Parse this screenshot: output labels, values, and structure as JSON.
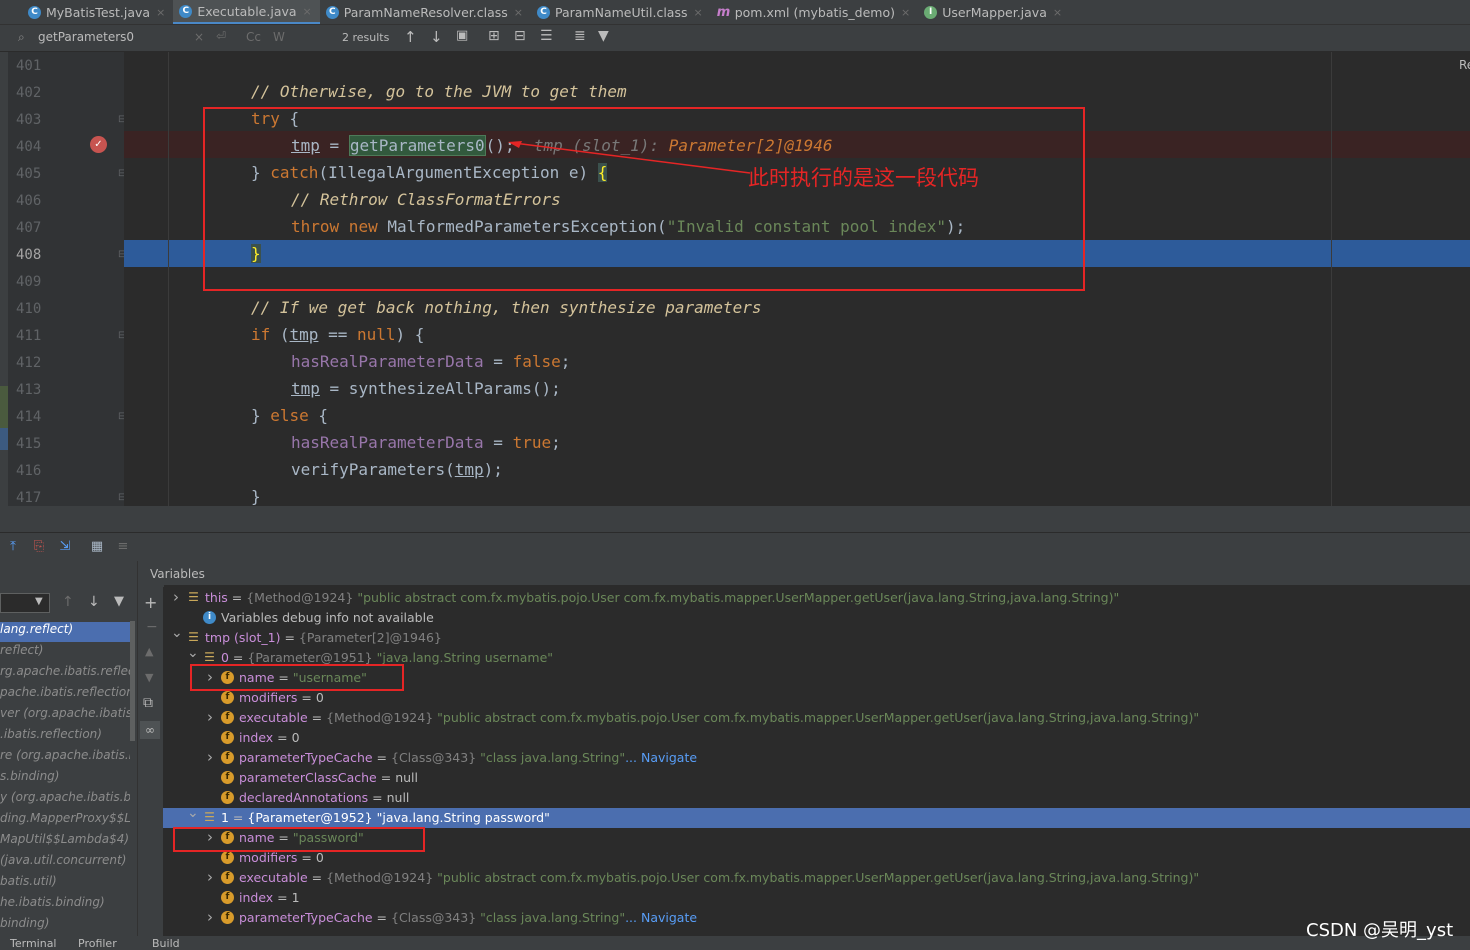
{
  "tabs": [
    {
      "label": "MyBatisTest.java",
      "icon": "java-class-icon",
      "color": "#3f8ac8"
    },
    {
      "label": "Executable.java",
      "icon": "java-class-icon",
      "color": "#3f8ac8",
      "active": true
    },
    {
      "label": "ParamNameResolver.class",
      "icon": "class-file-icon",
      "color": "#3f8ac8"
    },
    {
      "label": "ParamNameUtil.class",
      "icon": "class-file-icon",
      "color": "#3f8ac8"
    },
    {
      "label": "pom.xml (mybatis_demo)",
      "icon": "maven-icon",
      "color": "#c67ecb"
    },
    {
      "label": "UserMapper.java",
      "icon": "interface-icon",
      "color": "#6aab73"
    }
  ],
  "find": {
    "value": "getParameters0",
    "results": "2 results",
    "cc": "Cc",
    "w": "W"
  },
  "editor": {
    "line_numbers": [
      "401",
      "402",
      "403",
      "404",
      "405",
      "406",
      "407",
      "408",
      "409",
      "410",
      "411",
      "412",
      "413",
      "414",
      "415",
      "416",
      "417"
    ],
    "current_line": "408",
    "right_edge_label": "Re",
    "annotation": "此时执行的是这一段代码"
  },
  "code": {
    "l402": "// Otherwise, go to the JVM to get them",
    "l403_kw": "try",
    "l403_brace": " {",
    "l404_var": "tmp",
    "l404_eq": " = ",
    "l404_call": "getParameters0",
    "l404_tail": "();",
    "l404_hint": "tmp (slot_1):",
    "l404_hintval": "Parameter[2]@1946",
    "l405_a": "} ",
    "l405_kw": "catch",
    "l405_b": "(IllegalArgumentException e) ",
    "l405_brace": "{",
    "l406": "// Rethrow ClassFormatErrors",
    "l407_kw1": "throw",
    "l407_kw2": " new",
    "l407_cls": " MalformedParametersException(",
    "l407_str": "\"Invalid constant pool index\"",
    "l407_end": ");",
    "l408": "}",
    "l410": "// If we get back nothing, then synthesize parameters",
    "l411_kw": "if",
    "l411_a": " (",
    "l411_var": "tmp",
    "l411_b": " == ",
    "l411_null": "null",
    "l411_c": ") {",
    "l412_fld": "hasRealParameterData",
    "l412_a": " = ",
    "l412_val": "false",
    "l412_b": ";",
    "l413_var": "tmp",
    "l413_a": " = synthesizeAllParams();",
    "l414_a": "} ",
    "l414_kw": "else",
    "l414_b": " {",
    "l415_fld": "hasRealParameterData",
    "l415_a": " = ",
    "l415_val": "true",
    "l415_b": ";",
    "l416_a": "verifyParameters(",
    "l416_var": "tmp",
    "l416_b": ");",
    "l417": "}"
  },
  "debug": {
    "variables_title": "Variables",
    "frames": [
      "lang.reflect)",
      "reflect)",
      "rg.apache.ibatis.reflectio",
      "pache.ibatis.reflection)",
      "ver (org.apache.ibatis.re",
      ".ibatis.reflection)",
      "re (org.apache.ibatis.bi",
      "s.binding)",
      "y (org.apache.ibatis.bin",
      "ding.MapperProxy$$Lam",
      "MapUtil$$Lambda$4)",
      "(java.util.concurrent)",
      "batis.util)",
      "he.ibatis.binding)",
      "binding)"
    ],
    "variables": [
      {
        "name": "this",
        "eq": " = ",
        "ref": "{Method@1924}",
        "val": " \"public abstract com.fx.mybatis.pojo.User com.fx.mybatis.mapper.UserMapper.getUser(java.lang.String,java.lang.String)\""
      },
      {
        "info": "Variables debug info not available"
      },
      {
        "name": "tmp (slot_1)",
        "eq": " = ",
        "ref": "{Parameter[2]@1946}"
      },
      {
        "name": "0",
        "eq": " = ",
        "ref": "{Parameter@1951}",
        "val": " \"java.lang.String username\""
      },
      {
        "name": "name",
        "eq": " = ",
        "val": "\"username\""
      },
      {
        "name": "modifiers",
        "eq": " = ",
        "plain": "0"
      },
      {
        "name": "executable",
        "eq": " = ",
        "ref": "{Method@1924}",
        "val": " \"public abstract com.fx.mybatis.pojo.User com.fx.mybatis.mapper.UserMapper.getUser(java.lang.String,java.lang.String)\""
      },
      {
        "name": "index",
        "eq": " = ",
        "plain": "0"
      },
      {
        "name": "parameterTypeCache",
        "eq": " = ",
        "ref": "{Class@343}",
        "val": " \"class java.lang.String\"",
        "nav": "... Navigate"
      },
      {
        "name": "parameterClassCache",
        "eq": " = ",
        "plain": "null"
      },
      {
        "name": "declaredAnnotations",
        "eq": " = ",
        "plain": "null"
      },
      {
        "name": "1",
        "eq": " = ",
        "ref": "{Parameter@1952}",
        "val": " \"java.lang.String password\""
      },
      {
        "name": "name",
        "eq": " = ",
        "val": "\"password\""
      },
      {
        "name": "modifiers",
        "eq": " = ",
        "plain": "0"
      },
      {
        "name": "executable",
        "eq": " = ",
        "ref": "{Method@1924}",
        "val": " \"public abstract com.fx.mybatis.pojo.User com.fx.mybatis.mapper.UserMapper.getUser(java.lang.String,java.lang.String)\""
      },
      {
        "name": "index",
        "eq": " = ",
        "plain": "1"
      },
      {
        "name": "parameterTypeCache",
        "eq": " = ",
        "ref": "{Class@343}",
        "val": " \"class java.lang.String\"",
        "nav": "... Navigate"
      }
    ]
  },
  "statusbar": {
    "terminal": "Terminal",
    "profiler": "Profiler",
    "build": "Build"
  },
  "watermark": "CSDN @吴明_yst"
}
